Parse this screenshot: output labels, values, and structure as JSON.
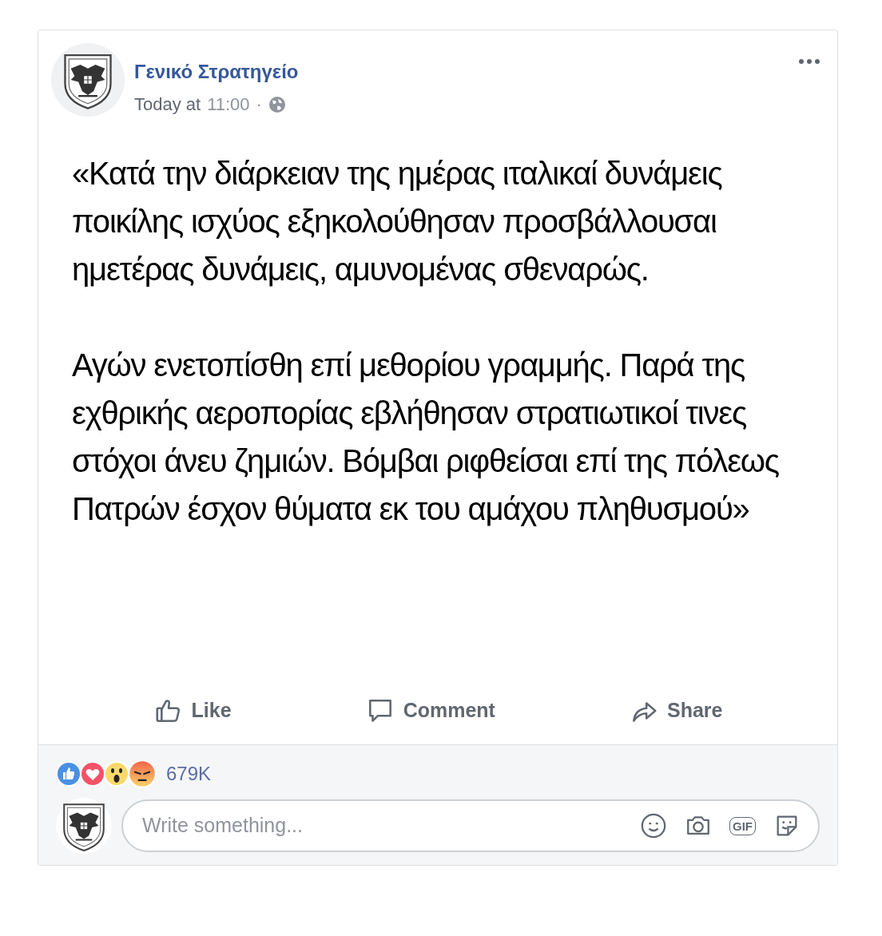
{
  "post": {
    "author": "Γενικό Στρατηγείο",
    "time_prefix": "Today at",
    "time": "11:00",
    "separator": "·",
    "paragraphs": [
      "«Κατά την διάρκειαν της ημέρας ιταλικαί δυνάμεις ποικίλης ισχύος εξηκολούθησαν προσβάλλουσαι ημετέρας δυνάμεις, αμυνομένας σθεναρώς.",
      "Αγών ενετοπίσθη επί μεθορίου γραμμής. Παρά της εχθρικής αεροπορίας εβλήθησαν στρατιωτικοί τινες στόχοι άνευ ζημιών. Βόμβαι ριφθείσαι επί της πόλεως Πατρών έσχον θύματα εκ του αμάχου πληθυσμού»"
    ]
  },
  "actions": [
    {
      "kind": "like",
      "label": "Like"
    },
    {
      "kind": "comment",
      "label": "Comment"
    },
    {
      "kind": "share",
      "label": "Share"
    }
  ],
  "reactions": {
    "types": [
      {
        "kind": "like"
      },
      {
        "kind": "love"
      },
      {
        "kind": "wow"
      },
      {
        "kind": "angry"
      }
    ],
    "count": "679K"
  },
  "comment_box": {
    "placeholder": "Write something...",
    "gif_label": "GIF"
  }
}
